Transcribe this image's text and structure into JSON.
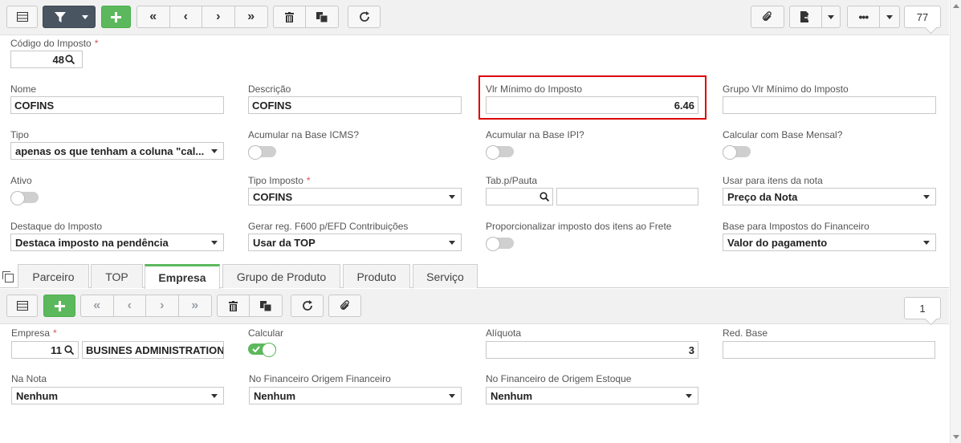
{
  "toolbar": {
    "record_count": "77"
  },
  "header": {
    "codigo_label": "Código do Imposto",
    "codigo_value": "48"
  },
  "fields": {
    "nome": {
      "label": "Nome",
      "value": "COFINS"
    },
    "descricao": {
      "label": "Descrição",
      "value": "COFINS"
    },
    "vlr_minimo": {
      "label": "Vlr Mínimo do Imposto",
      "value": "6.46"
    },
    "grupo_vlr_minimo": {
      "label": "Grupo Vlr Mínimo do Imposto",
      "value": ""
    },
    "tipo": {
      "label": "Tipo",
      "value": "apenas os que tenham a coluna \"cal..."
    },
    "acumular_icms": {
      "label": "Acumular na Base ICMS?",
      "checked": false
    },
    "acumular_ipi": {
      "label": "Acumular na Base IPI?",
      "checked": false
    },
    "calcular_base_mensal": {
      "label": "Calcular com Base Mensal?",
      "checked": false
    },
    "ativo": {
      "label": "Ativo",
      "checked": false
    },
    "tipo_imposto": {
      "label": "Tipo Imposto",
      "value": "COFINS"
    },
    "tab_pauta": {
      "label": "Tab.p/Pauta",
      "value": ""
    },
    "usar_itens_nota": {
      "label": "Usar para itens da nota",
      "value": "Preço da Nota"
    },
    "destaque": {
      "label": "Destaque do Imposto",
      "value": "Destaca imposto na pendência"
    },
    "gerar_f600": {
      "label": "Gerar reg. F600 p/EFD Contribuições",
      "value": "Usar da TOP"
    },
    "proporcionalizar": {
      "label": "Proporcionalizar imposto dos itens ao Frete",
      "checked": false
    },
    "base_financeiro": {
      "label": "Base para Impostos do Financeiro",
      "value": "Valor do pagamento"
    }
  },
  "tabs": [
    "Parceiro",
    "TOP",
    "Empresa",
    "Grupo de Produto",
    "Produto",
    "Serviço"
  ],
  "subtoolbar": {
    "record_count": "1"
  },
  "detail": {
    "empresa": {
      "label": "Empresa",
      "code": "11",
      "name": "BUSINES ADMINISTRATION"
    },
    "calcular": {
      "label": "Calcular",
      "checked": true
    },
    "aliquota": {
      "label": "Alíquota",
      "value": "3"
    },
    "red_base": {
      "label": "Red. Base",
      "value": ""
    },
    "na_nota": {
      "label": "Na Nota",
      "value": "Nenhum"
    },
    "fin_origem_financeiro": {
      "label": "No Financeiro Origem Financeiro",
      "value": "Nenhum"
    },
    "fin_origem_estoque": {
      "label": "No Financeiro de Origem Estoque",
      "value": "Nenhum"
    }
  }
}
